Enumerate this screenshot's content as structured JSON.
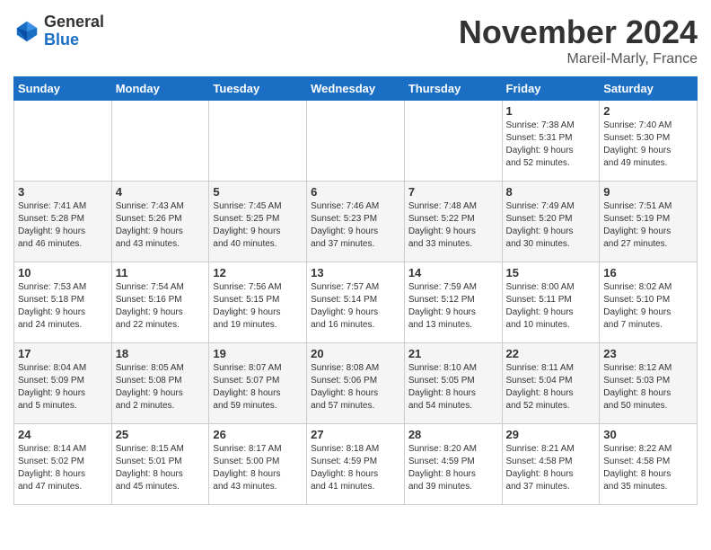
{
  "logo": {
    "general": "General",
    "blue": "Blue"
  },
  "title": "November 2024",
  "location": "Mareil-Marly, France",
  "days_of_week": [
    "Sunday",
    "Monday",
    "Tuesday",
    "Wednesday",
    "Thursday",
    "Friday",
    "Saturday"
  ],
  "weeks": [
    [
      {
        "day": "",
        "info": ""
      },
      {
        "day": "",
        "info": ""
      },
      {
        "day": "",
        "info": ""
      },
      {
        "day": "",
        "info": ""
      },
      {
        "day": "",
        "info": ""
      },
      {
        "day": "1",
        "info": "Sunrise: 7:38 AM\nSunset: 5:31 PM\nDaylight: 9 hours\nand 52 minutes."
      },
      {
        "day": "2",
        "info": "Sunrise: 7:40 AM\nSunset: 5:30 PM\nDaylight: 9 hours\nand 49 minutes."
      }
    ],
    [
      {
        "day": "3",
        "info": "Sunrise: 7:41 AM\nSunset: 5:28 PM\nDaylight: 9 hours\nand 46 minutes."
      },
      {
        "day": "4",
        "info": "Sunrise: 7:43 AM\nSunset: 5:26 PM\nDaylight: 9 hours\nand 43 minutes."
      },
      {
        "day": "5",
        "info": "Sunrise: 7:45 AM\nSunset: 5:25 PM\nDaylight: 9 hours\nand 40 minutes."
      },
      {
        "day": "6",
        "info": "Sunrise: 7:46 AM\nSunset: 5:23 PM\nDaylight: 9 hours\nand 37 minutes."
      },
      {
        "day": "7",
        "info": "Sunrise: 7:48 AM\nSunset: 5:22 PM\nDaylight: 9 hours\nand 33 minutes."
      },
      {
        "day": "8",
        "info": "Sunrise: 7:49 AM\nSunset: 5:20 PM\nDaylight: 9 hours\nand 30 minutes."
      },
      {
        "day": "9",
        "info": "Sunrise: 7:51 AM\nSunset: 5:19 PM\nDaylight: 9 hours\nand 27 minutes."
      }
    ],
    [
      {
        "day": "10",
        "info": "Sunrise: 7:53 AM\nSunset: 5:18 PM\nDaylight: 9 hours\nand 24 minutes."
      },
      {
        "day": "11",
        "info": "Sunrise: 7:54 AM\nSunset: 5:16 PM\nDaylight: 9 hours\nand 22 minutes."
      },
      {
        "day": "12",
        "info": "Sunrise: 7:56 AM\nSunset: 5:15 PM\nDaylight: 9 hours\nand 19 minutes."
      },
      {
        "day": "13",
        "info": "Sunrise: 7:57 AM\nSunset: 5:14 PM\nDaylight: 9 hours\nand 16 minutes."
      },
      {
        "day": "14",
        "info": "Sunrise: 7:59 AM\nSunset: 5:12 PM\nDaylight: 9 hours\nand 13 minutes."
      },
      {
        "day": "15",
        "info": "Sunrise: 8:00 AM\nSunset: 5:11 PM\nDaylight: 9 hours\nand 10 minutes."
      },
      {
        "day": "16",
        "info": "Sunrise: 8:02 AM\nSunset: 5:10 PM\nDaylight: 9 hours\nand 7 minutes."
      }
    ],
    [
      {
        "day": "17",
        "info": "Sunrise: 8:04 AM\nSunset: 5:09 PM\nDaylight: 9 hours\nand 5 minutes."
      },
      {
        "day": "18",
        "info": "Sunrise: 8:05 AM\nSunset: 5:08 PM\nDaylight: 9 hours\nand 2 minutes."
      },
      {
        "day": "19",
        "info": "Sunrise: 8:07 AM\nSunset: 5:07 PM\nDaylight: 8 hours\nand 59 minutes."
      },
      {
        "day": "20",
        "info": "Sunrise: 8:08 AM\nSunset: 5:06 PM\nDaylight: 8 hours\nand 57 minutes."
      },
      {
        "day": "21",
        "info": "Sunrise: 8:10 AM\nSunset: 5:05 PM\nDaylight: 8 hours\nand 54 minutes."
      },
      {
        "day": "22",
        "info": "Sunrise: 8:11 AM\nSunset: 5:04 PM\nDaylight: 8 hours\nand 52 minutes."
      },
      {
        "day": "23",
        "info": "Sunrise: 8:12 AM\nSunset: 5:03 PM\nDaylight: 8 hours\nand 50 minutes."
      }
    ],
    [
      {
        "day": "24",
        "info": "Sunrise: 8:14 AM\nSunset: 5:02 PM\nDaylight: 8 hours\nand 47 minutes."
      },
      {
        "day": "25",
        "info": "Sunrise: 8:15 AM\nSunset: 5:01 PM\nDaylight: 8 hours\nand 45 minutes."
      },
      {
        "day": "26",
        "info": "Sunrise: 8:17 AM\nSunset: 5:00 PM\nDaylight: 8 hours\nand 43 minutes."
      },
      {
        "day": "27",
        "info": "Sunrise: 8:18 AM\nSunset: 4:59 PM\nDaylight: 8 hours\nand 41 minutes."
      },
      {
        "day": "28",
        "info": "Sunrise: 8:20 AM\nSunset: 4:59 PM\nDaylight: 8 hours\nand 39 minutes."
      },
      {
        "day": "29",
        "info": "Sunrise: 8:21 AM\nSunset: 4:58 PM\nDaylight: 8 hours\nand 37 minutes."
      },
      {
        "day": "30",
        "info": "Sunrise: 8:22 AM\nSunset: 4:58 PM\nDaylight: 8 hours\nand 35 minutes."
      }
    ]
  ]
}
